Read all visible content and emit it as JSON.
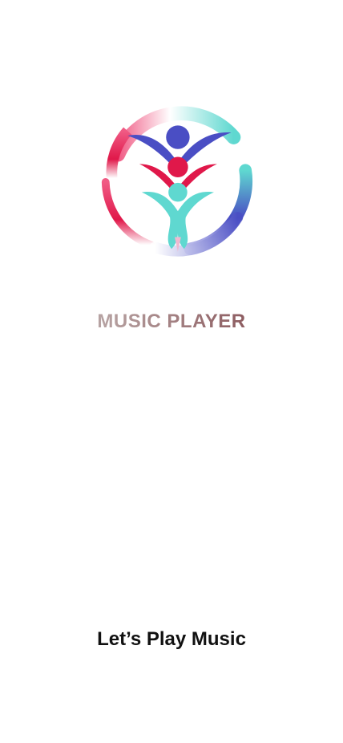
{
  "splash": {
    "logo_icon": "music-player-logo-icon",
    "app_name": "MUSIC PLAYER",
    "tagline": "Let’s Play Music"
  },
  "colors": {
    "background": "#ffffff",
    "tagline": "#111111",
    "logo_navy": "#4a4ec4",
    "logo_red": "#e0184a",
    "logo_teal": "#5fd8d0",
    "logo_pink": "#f05a84"
  }
}
